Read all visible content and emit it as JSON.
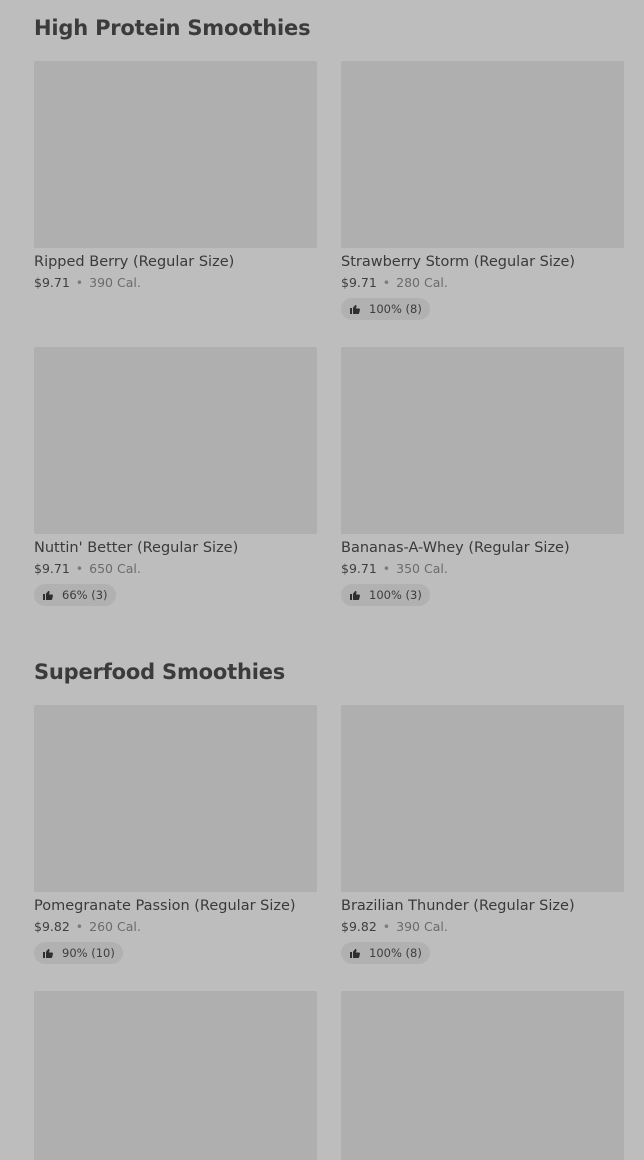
{
  "sections": [
    {
      "title": "High Protein Smoothies",
      "items": [
        {
          "name": "Ripped Berry (Regular Size)",
          "price": "$9.71",
          "separator": "•",
          "calories": "390 Cal.",
          "rating": ""
        },
        {
          "name": "Strawberry Storm (Regular Size)",
          "price": "$9.71",
          "separator": "•",
          "calories": "280 Cal.",
          "rating": "100% (8)"
        },
        {
          "name": "Nuttin' Better (Regular Size)",
          "price": "$9.71",
          "separator": "•",
          "calories": "650 Cal.",
          "rating": "66% (3)"
        },
        {
          "name": "Bananas-A-Whey (Regular Size)",
          "price": "$9.71",
          "separator": "•",
          "calories": "350 Cal.",
          "rating": "100% (3)"
        }
      ]
    },
    {
      "title": "Superfood Smoothies",
      "items": [
        {
          "name": "Pomegranate Passion (Regular Size)",
          "price": "$9.82",
          "separator": "•",
          "calories": "260 Cal.",
          "rating": "90% (10)"
        },
        {
          "name": "Brazilian Thunder (Regular Size)",
          "price": "$9.82",
          "separator": "•",
          "calories": "390 Cal.",
          "rating": "100% (8)"
        }
      ]
    }
  ],
  "icons": {
    "rating": "thumbs-up-icon"
  },
  "colors": {
    "background": "#bdbdbd",
    "image_placeholder": "#afafaf",
    "rating_pill": "#b1b1b1"
  }
}
